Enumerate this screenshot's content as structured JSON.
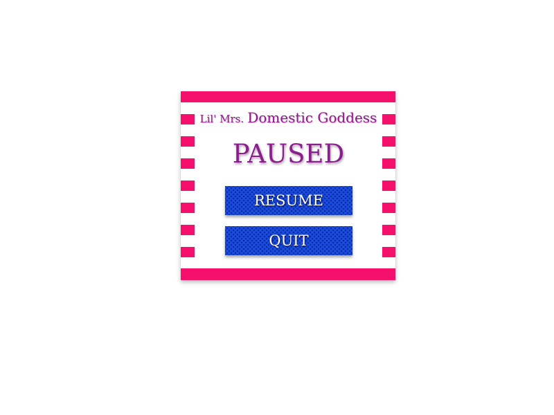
{
  "pause_menu": {
    "title_prefix": "Lil' Mrs.",
    "title_main": "Domestic Goddess",
    "heading": "PAUSED",
    "buttons": {
      "resume": "RESUME",
      "quit": "QUIT"
    }
  },
  "colors": {
    "frame_pink": "#f4106b",
    "title_purple": "#8e1a8a",
    "button_blue": "#1c4fe3",
    "background": "#ffffff"
  }
}
